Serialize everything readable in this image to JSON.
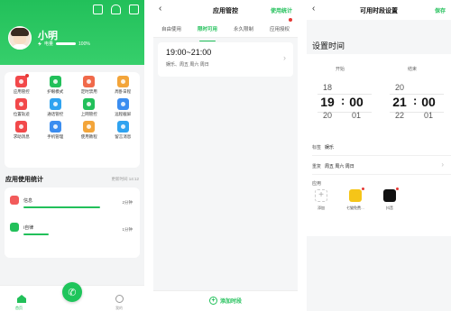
{
  "home": {
    "username": "小明",
    "battery_label": "电量",
    "battery_pct_text": "100%",
    "battery_level": 1.0,
    "top_icons": [
      "device-icon",
      "bell-icon",
      "menu-icon"
    ],
    "functions": [
      {
        "label": "应用管控",
        "icon": "app-control-icon",
        "color": "#f2484a",
        "badge": true
      },
      {
        "label": "护眼模式",
        "icon": "eye-icon",
        "color": "#22c05a",
        "badge": false
      },
      {
        "label": "定时禁用",
        "icon": "timer-icon",
        "color": "#f0694a",
        "badge": false
      },
      {
        "label": "周卧日程",
        "icon": "calendar-icon",
        "color": "#f3a53a",
        "badge": false
      },
      {
        "label": "位置轨迹",
        "icon": "location-icon",
        "color": "#f2484a",
        "badge": false
      },
      {
        "label": "通话管控",
        "icon": "phone-icon",
        "color": "#2fa3f0",
        "badge": false
      },
      {
        "label": "上网管控",
        "icon": "shield-icon",
        "color": "#22c05a",
        "badge": false
      },
      {
        "label": "远程截屏",
        "icon": "screenshot-icon",
        "color": "#3b8df0",
        "badge": false
      },
      {
        "label": "求助消息",
        "icon": "help-icon",
        "color": "#f2484a",
        "badge": false
      },
      {
        "label": "手机管理",
        "icon": "phone-manage-icon",
        "color": "#3b8df0",
        "badge": false
      },
      {
        "label": "使用教程",
        "icon": "tutorial-icon",
        "color": "#f3a53a",
        "badge": false
      },
      {
        "label": "留言消息",
        "icon": "message-icon",
        "color": "#2fa3f0",
        "badge": false
      }
    ],
    "stats_title": "应用使用统计",
    "stats_updated": "更新时间 14:12",
    "apps": [
      {
        "name": "信息",
        "duration": "2分钟",
        "color": "#f25b5b",
        "usage_fraction": 0.85
      },
      {
        "name": "i自律",
        "duration": "1分钟",
        "color": "#22c05a",
        "usage_fraction": 0.28
      }
    ],
    "nav": {
      "home_label": "首页",
      "me_label": "我的",
      "call_icon": "phone-call-icon"
    }
  },
  "app_control": {
    "title": "应用管控",
    "action": "使用统计",
    "tabs": [
      "自由使用",
      "限时可用",
      "永久限制",
      "应用授权"
    ],
    "active_tab": 1,
    "rule_time": "19:00~21:00",
    "rule_days": "娱乐、周五 周六 周日",
    "add_label": "添加时段"
  },
  "time_settings": {
    "title": "可用时段设置",
    "save": "保存",
    "section_title": "设置时间",
    "start_label": "开始",
    "end_label": "结束",
    "start": {
      "hours": [
        "18",
        "19",
        "20"
      ],
      "minutes": [
        "",
        "00",
        "01"
      ]
    },
    "end": {
      "hours": [
        "20",
        "21",
        "22"
      ],
      "minutes": [
        "",
        "00",
        "01"
      ]
    },
    "tag_label": "标签",
    "tag_value": "娱乐",
    "repeat_label": "重复",
    "repeat_value": "周五 周六 周日",
    "apps_label": "应用",
    "app_tiles": [
      {
        "label": "添加",
        "icon": "add-icon"
      },
      {
        "label": "七猫免费…",
        "icon": "qimao-icon",
        "color": "#f5c518"
      },
      {
        "label": "抖音",
        "icon": "douyin-icon",
        "color": "#111111"
      }
    ]
  }
}
